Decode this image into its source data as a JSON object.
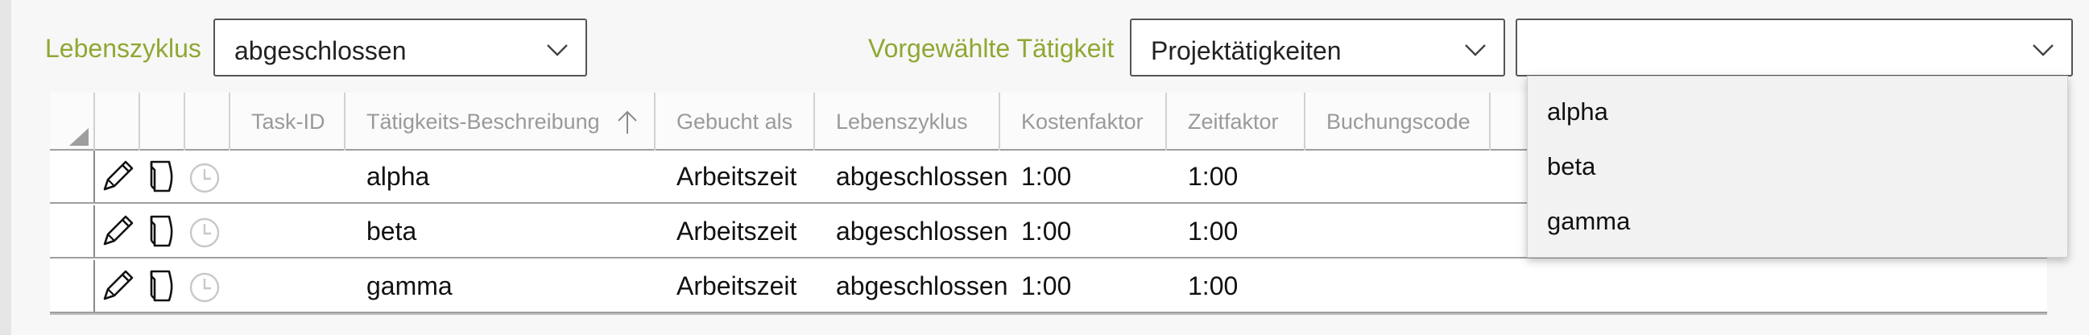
{
  "filters": {
    "lifecycle_label": "Lebenszyklus",
    "lifecycle_value": "abgeschlossen",
    "activity_label": "Vorgewählte Tätigkeit",
    "activity_value": "Projektätigkeiten",
    "third_value": ""
  },
  "table": {
    "columns": [
      "Task-ID",
      "Tätigkeits-Beschreibung",
      "Gebucht als",
      "Lebenszyklus",
      "Kostenfaktor",
      "Zeitfaktor",
      "Buchungscode"
    ],
    "sort": {
      "column": "Tätigkeits-Beschreibung",
      "direction": "ascending"
    },
    "rows": [
      {
        "task_id": "",
        "description": "alpha",
        "booked_as": "Arbeitszeit",
        "lifecycle": "abgeschlossen",
        "cost_factor": "1:00",
        "time_factor": "1:00",
        "booking_code": ""
      },
      {
        "task_id": "",
        "description": "beta",
        "booked_as": "Arbeitszeit",
        "lifecycle": "abgeschlossen",
        "cost_factor": "1:00",
        "time_factor": "1:00",
        "booking_code": ""
      },
      {
        "task_id": "",
        "description": "gamma",
        "booked_as": "Arbeitszeit",
        "lifecycle": "abgeschlossen",
        "cost_factor": "1:00",
        "time_factor": "1:00",
        "booking_code": ""
      }
    ]
  },
  "dropdown": {
    "options": [
      "alpha",
      "beta",
      "gamma"
    ]
  },
  "icons": {
    "row_actions": [
      "pencil-icon",
      "document-icon",
      "clock-icon"
    ],
    "corner": "select-all-triangle-icon",
    "sort": "arrow-up-icon",
    "chevron": "chevron-down-icon"
  },
  "colors": {
    "label_accent": "#8ea832",
    "clock_icon": "#c8c8c8"
  }
}
